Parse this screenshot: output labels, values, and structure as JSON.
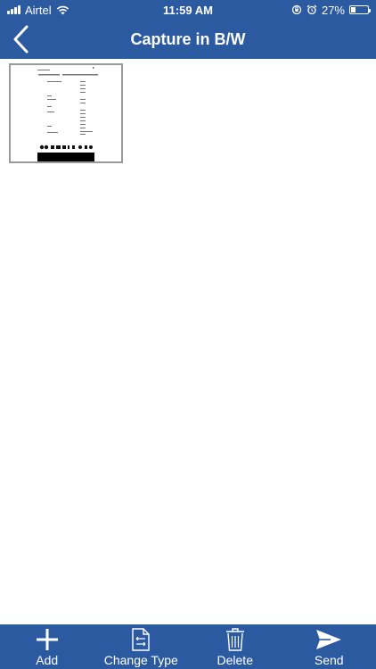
{
  "status": {
    "carrier": "Airtel",
    "time": "11:59 AM",
    "battery": "27%",
    "battery_level": 0.27
  },
  "header": {
    "title": "Capture in B/W"
  },
  "toolbar": {
    "add_label": "Add",
    "change_type_label": "Change Type",
    "delete_label": "Delete",
    "send_label": "Send"
  },
  "colors": {
    "accent": "#2c5aa0",
    "background": "#ffffff",
    "thumb_border": "#9a9a9a"
  },
  "icons": {
    "back": "chevron-left-icon",
    "add": "plus-icon",
    "change_type": "document-swap-icon",
    "delete": "trash-icon",
    "send": "paper-plane-icon"
  }
}
